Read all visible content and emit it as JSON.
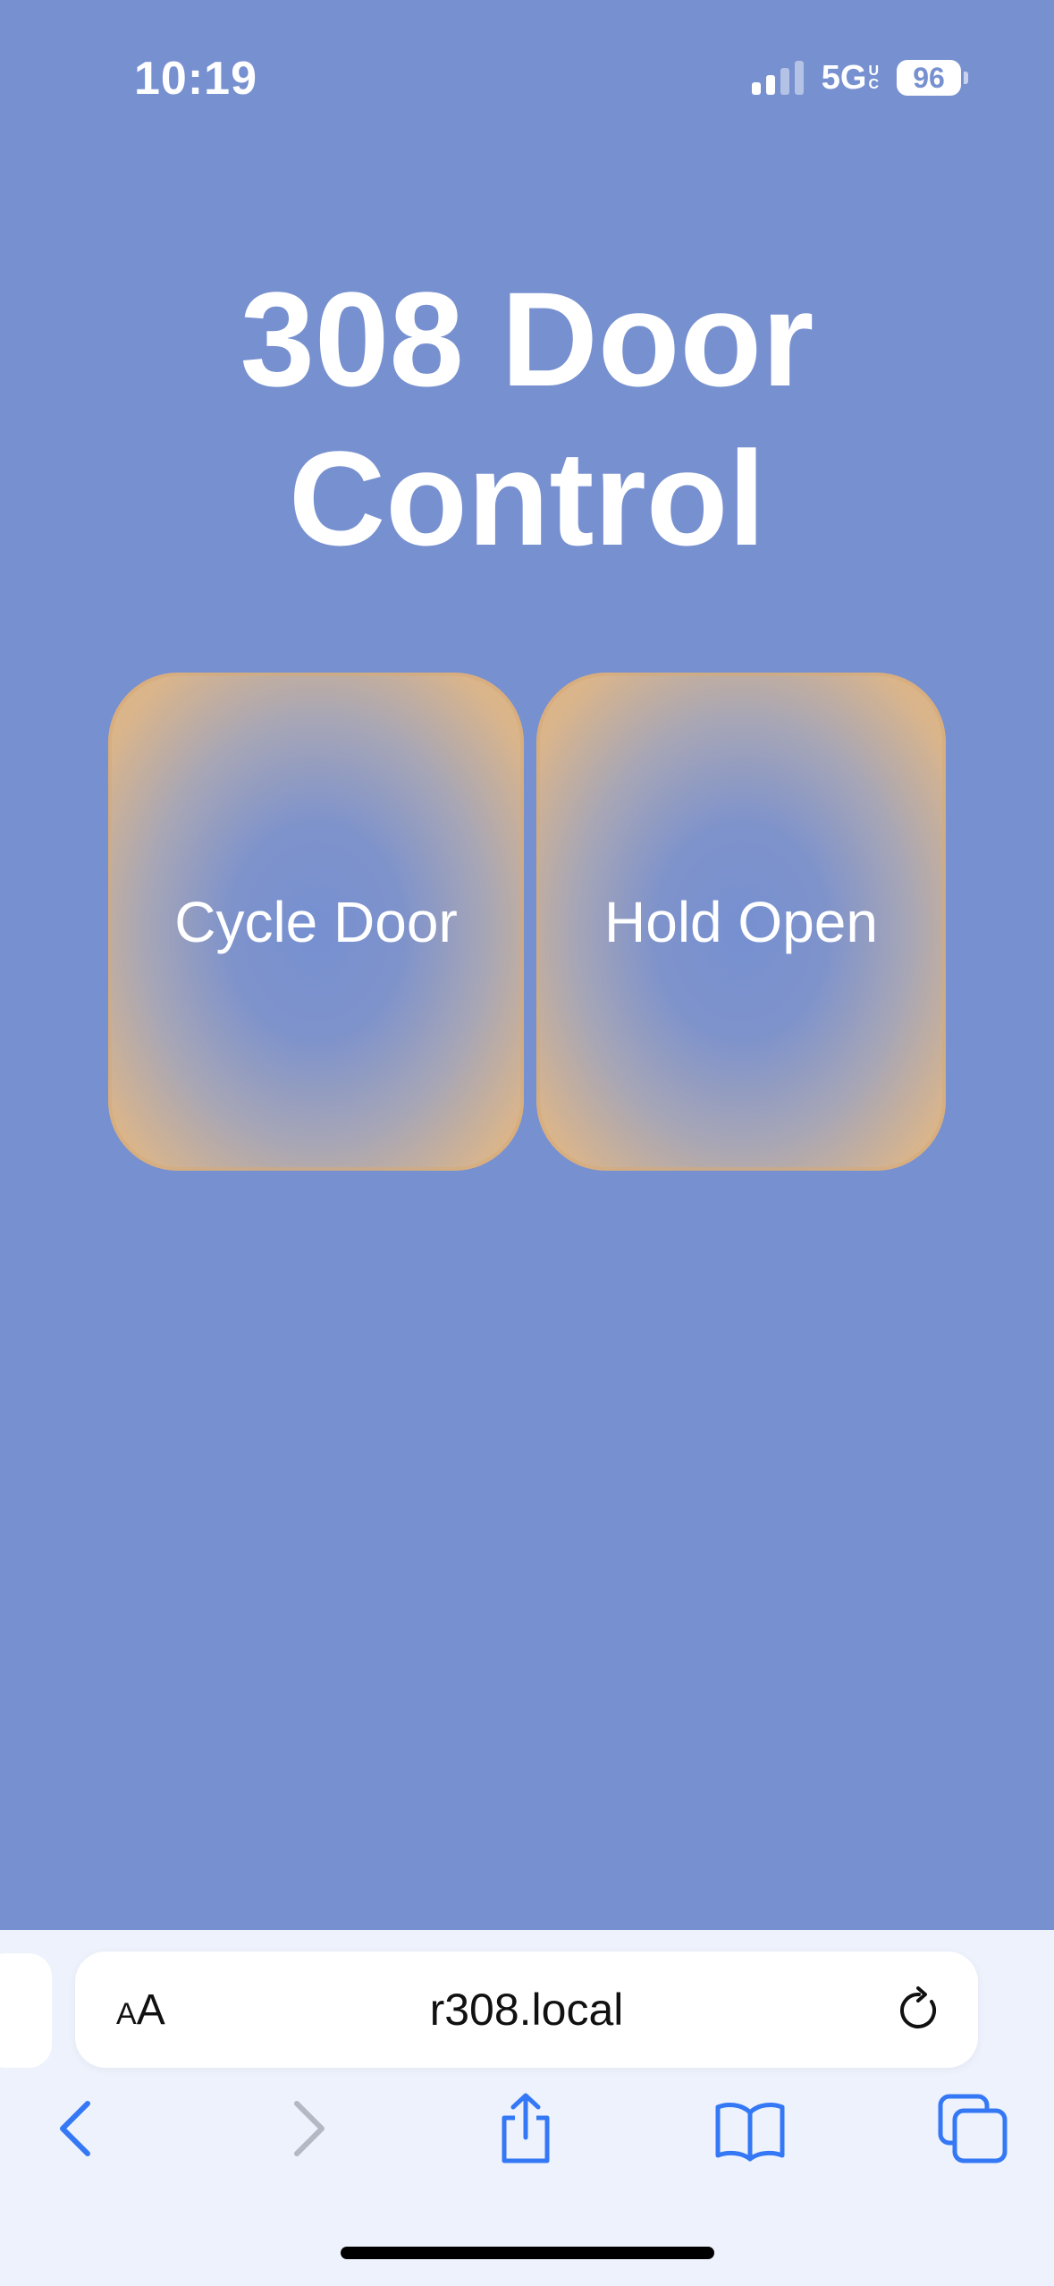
{
  "status_bar": {
    "time": "10:19",
    "network": "5G",
    "network_suffix_top": "U",
    "network_suffix_bottom": "C",
    "battery": "96",
    "signal_icon": "cellular-signal-icon"
  },
  "page": {
    "title_line1": "308 Door",
    "title_line2": "Control",
    "background_color": "#7790d0"
  },
  "buttons": {
    "cycle_door": "Cycle Door",
    "hold_open": "Hold Open",
    "accent_color": "#dfb588"
  },
  "browser": {
    "text_size_small": "A",
    "text_size_large": "A",
    "url": "r308.local",
    "icons": {
      "reload": "reload-icon",
      "back": "chevron-left-icon",
      "forward": "chevron-right-icon",
      "share": "share-icon",
      "bookmarks": "book-icon",
      "tabs": "tabs-icon"
    },
    "icon_color": "#3478f6"
  }
}
